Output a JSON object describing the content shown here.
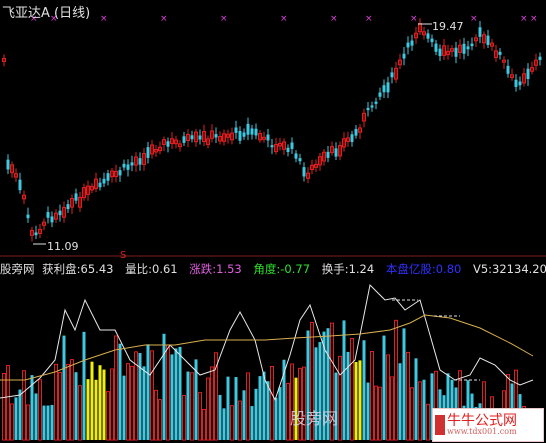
{
  "header": {
    "title": "飞亚达A (日线)"
  },
  "price_annotations": {
    "high": "19.47",
    "low": "11.09",
    "s_mark": "S"
  },
  "indicator_bar": {
    "name": "股旁网",
    "items": [
      {
        "label": "获利盘:",
        "value": "65.43",
        "color": "#e0e0e0"
      },
      {
        "label": "量比:",
        "value": "0.61",
        "color": "#e0e0e0"
      },
      {
        "label": "涨跌:",
        "value": "1.53",
        "color": "#e060e0"
      },
      {
        "label": "角度:",
        "value": "-0.77",
        "color": "#30e030"
      },
      {
        "label": "换手:",
        "value": "1.24",
        "color": "#e0e0e0"
      },
      {
        "label": "本盘亿股:",
        "value": "0.80",
        "color": "#3030ff"
      },
      {
        "label": "V5:",
        "value": "32134.20",
        "color": "#e0e0e0"
      },
      {
        "label": "V",
        "value": "",
        "color": "#e0e0e0"
      }
    ]
  },
  "watermarks": {
    "left": "股旁网",
    "right_main": "牛牛公式网",
    "right_sub": "www.tdx001.com"
  },
  "colors": {
    "up": "#e02020",
    "down": "#40c8e0",
    "yellow": "#f0f000",
    "marker": "#e040e0",
    "avg": "#d8b050"
  }
}
